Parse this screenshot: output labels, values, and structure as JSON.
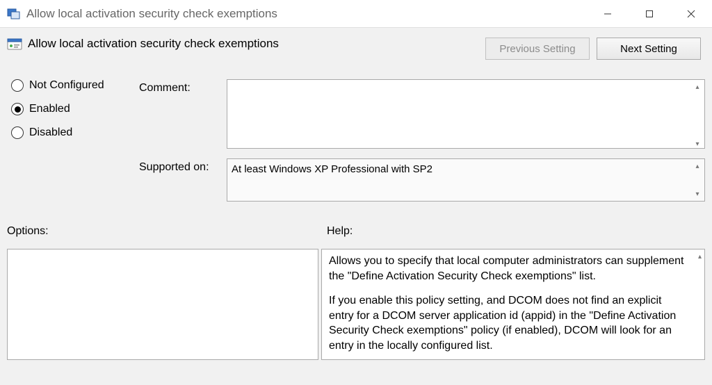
{
  "window": {
    "title": "Allow local activation security check exemptions"
  },
  "header": {
    "policy_name": "Allow local activation security check exemptions",
    "prev_btn": "Previous Setting",
    "next_btn": "Next Setting"
  },
  "state": {
    "radios": {
      "not_configured": "Not Configured",
      "enabled": "Enabled",
      "disabled": "Disabled",
      "selected": "enabled"
    },
    "comment_label": "Comment:",
    "comment_value": "",
    "supported_label": "Supported on:",
    "supported_value": "At least Windows XP Professional with SP2"
  },
  "sections": {
    "options_label": "Options:",
    "help_label": "Help:"
  },
  "help": {
    "p1": "Allows you to specify that local computer administrators can supplement the \"Define Activation Security Check exemptions\" list.",
    "p2": "If you enable this policy setting, and DCOM does not find an explicit entry for a DCOM server application id (appid) in the \"Define Activation Security Check exemptions\" policy (if enabled), DCOM will look for an entry in the locally configured list."
  }
}
